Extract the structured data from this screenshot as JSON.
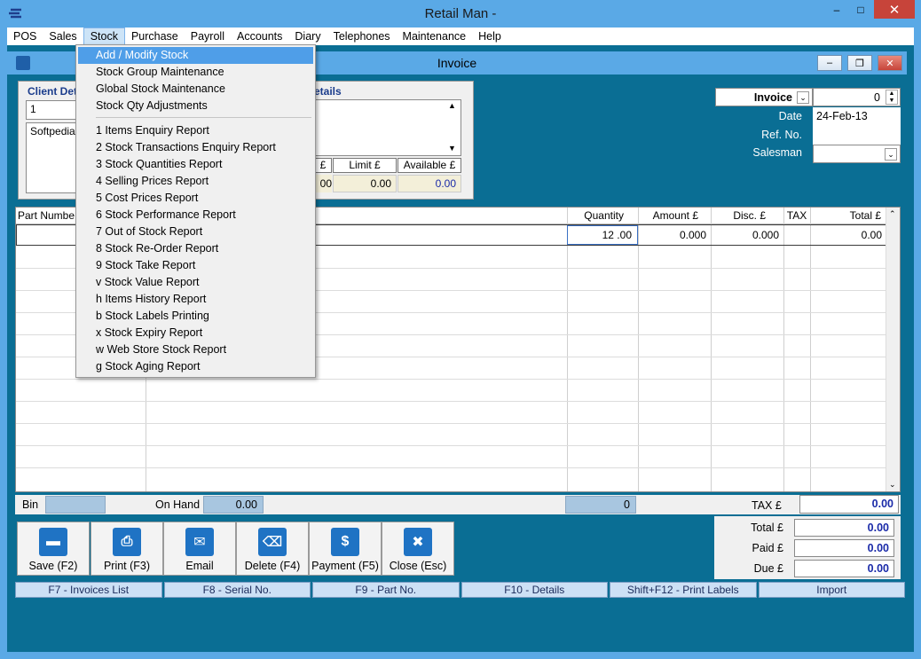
{
  "window": {
    "title": "Retail Man -",
    "child_title": "Invoice"
  },
  "menubar": {
    "items": [
      "POS",
      "Sales",
      "Stock",
      "Purchase",
      "Payroll",
      "Accounts",
      "Diary",
      "Telephones",
      "Maintenance",
      "Help"
    ],
    "active": "Stock"
  },
  "stock_menu": {
    "items": [
      "Add / Modify Stock",
      "Stock Group Maintenance",
      "Global Stock Maintenance",
      "Stock Qty Adjustments",
      "1 Items Enquiry Report",
      "2 Stock Transactions Enquiry Report",
      "3 Stock Quantities Report",
      "4 Selling Prices Report",
      "5 Cost Prices Report",
      "6 Stock Performance Report",
      "7 Out of Stock Report",
      "8 Stock Re-Order Report",
      "9 Stock Take Report",
      "v Stock Value Report",
      "h Items History Report",
      "b Stock Labels Printing",
      "x Stock Expiry Report",
      "w Web Store Stock Report",
      "g Stock Aging Report"
    ]
  },
  "client": {
    "heading": "Client Det",
    "details_heading": "etails",
    "id_value": "1",
    "name_value": "Softpedia",
    "col_headers": [
      "£",
      "Limit £",
      "Available £"
    ],
    "col_values": [
      "00",
      "0.00",
      "0.00"
    ]
  },
  "invoice_info": {
    "type": "Invoice",
    "number": "0",
    "date_label": "Date",
    "date_value": "24-Feb-13",
    "ref_label": "Ref. No.",
    "ref_value": "",
    "salesman_label": "Salesman",
    "salesman_value": ""
  },
  "grid": {
    "headers": [
      "Part Numbe",
      "Quantity",
      "Amount £",
      "Disc. £",
      "TAX",
      "Total £"
    ],
    "row1": {
      "quantity": "12 .00",
      "amount": "0.000",
      "disc": "0.000",
      "total": "0.00"
    }
  },
  "bin_bar": {
    "bin_label": "Bin",
    "onhand_label": "On Hand",
    "onhand_value": "0.00",
    "qty_total": "0",
    "tax_label": "TAX £",
    "tax_value": "0.00"
  },
  "actions": [
    "Save (F2)",
    "Print (F3)",
    "Email",
    "Delete (F4)",
    "Payment (F5)",
    "Close (Esc)"
  ],
  "totals": {
    "total_label": "Total £",
    "total_value": "0.00",
    "paid_label": "Paid £",
    "paid_value": "0.00",
    "due_label": "Due £",
    "due_value": "0.00"
  },
  "fkeys": [
    "F7 - Invoices List",
    "F8 - Serial No.",
    "F9 - Part No.",
    "F10 - Details",
    "Shift+F12 - Print Labels",
    "Import"
  ]
}
